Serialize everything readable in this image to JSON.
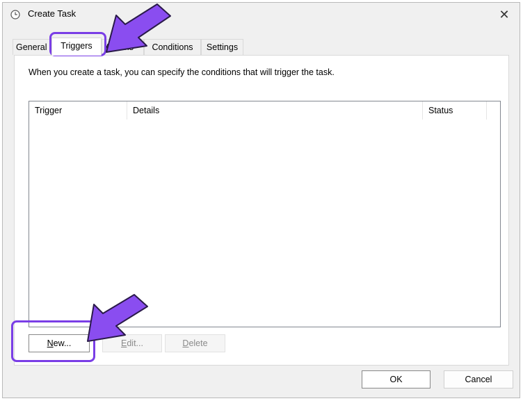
{
  "window": {
    "title": "Create Task",
    "close_glyph": "✕"
  },
  "tabs": [
    {
      "label": "General"
    },
    {
      "label": "Triggers"
    },
    {
      "label": "Actions"
    },
    {
      "label": "Conditions"
    },
    {
      "label": "Settings"
    }
  ],
  "active_tab": "Triggers",
  "triggers_panel": {
    "description": "When you create a task, you can specify the conditions that will trigger the task.",
    "columns": [
      "Trigger",
      "Details",
      "Status"
    ],
    "rows": []
  },
  "buttons": {
    "new": {
      "prefix": "",
      "accel": "N",
      "rest": "ew..."
    },
    "edit": {
      "prefix": "",
      "accel": "E",
      "rest": "dit..."
    },
    "delete": {
      "prefix": "",
      "accel": "D",
      "rest": "elete"
    }
  },
  "dialog_buttons": {
    "ok": "OK",
    "cancel": "Cancel"
  },
  "annotations": {
    "highlight_color": "#7a3ee6",
    "arrow_fill": "#8a4df0"
  },
  "icons": {
    "title": "clock-icon",
    "close": "close-icon"
  }
}
